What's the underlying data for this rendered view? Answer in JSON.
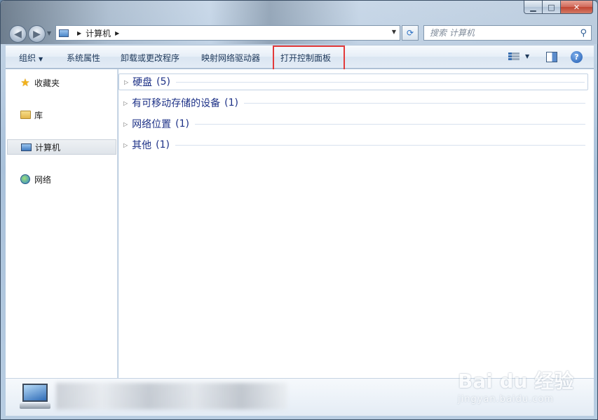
{
  "window": {
    "minimize_glyph": "▁",
    "maximize_glyph": "□",
    "close_glyph": "✕"
  },
  "navigation": {
    "back_glyph": "◀",
    "forward_glyph": "▶",
    "address_breadcrumb": [
      "计算机"
    ],
    "separator_glyph": "▶",
    "dropdown_glyph": "▼",
    "refresh_glyph": "⟳",
    "search_placeholder": "搜索 计算机",
    "search_icon": "magnifier-icon"
  },
  "toolbar": {
    "organize_label": "组织",
    "organize_caret": "▼",
    "system_properties_label": "系统属性",
    "uninstall_label": "卸载或更改程序",
    "map_drive_label": "映射网络驱动器",
    "open_control_panel_label": "打开控制面板",
    "view_caret": "▼",
    "help_glyph": "?",
    "highlight_color": "#e33a3a"
  },
  "sidebar": {
    "items": [
      {
        "label": "收藏夹",
        "icon": "star-icon"
      },
      {
        "label": "库",
        "icon": "library-folder-icon"
      },
      {
        "label": "计算机",
        "icon": "computer-icon",
        "selected": true
      },
      {
        "label": "网络",
        "icon": "network-icon"
      }
    ]
  },
  "content": {
    "groups": [
      {
        "label": "硬盘",
        "count": "(5)"
      },
      {
        "label": "有可移动存储的设备",
        "count": "(1)"
      },
      {
        "label": "网络位置",
        "count": "(1)"
      },
      {
        "label": "其他",
        "count": "(1)"
      }
    ],
    "expander_glyph": "▷"
  },
  "watermark": {
    "main": "Bai du 经验",
    "sub": "jingyan.baidu.com"
  }
}
